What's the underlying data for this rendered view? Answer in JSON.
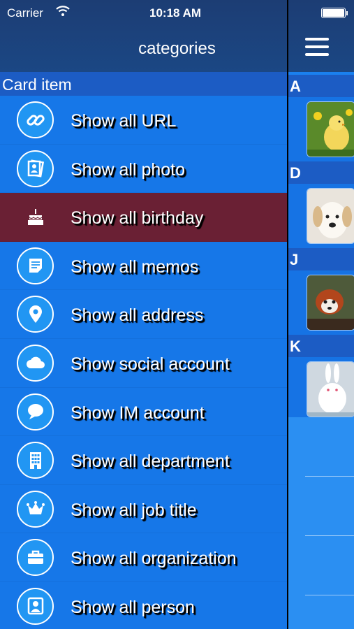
{
  "status_bar": {
    "carrier": "Carrier",
    "time": "10:18 AM"
  },
  "drawer": {
    "title": "categories",
    "section_header": "Card item",
    "items": [
      {
        "label": "Show all URL",
        "icon": "link-icon"
      },
      {
        "label": "Show all photo",
        "icon": "photos-icon"
      },
      {
        "label": "Show all birthday",
        "icon": "birthday-cake-icon",
        "selected": true
      },
      {
        "label": "Show all memos",
        "icon": "memo-icon"
      },
      {
        "label": "Show all address",
        "icon": "location-pin-icon"
      },
      {
        "label": "Show social account",
        "icon": "cloud-icon"
      },
      {
        "label": "Show IM account",
        "icon": "chat-bubble-icon"
      },
      {
        "label": "Show all department",
        "icon": "building-icon"
      },
      {
        "label": "Show all job title",
        "icon": "crown-icon"
      },
      {
        "label": "Show all organization",
        "icon": "briefcase-icon"
      },
      {
        "label": "Show all person",
        "icon": "person-icon"
      }
    ]
  },
  "contacts_peek": {
    "sections": [
      {
        "letter": "A",
        "thumb": "chick-photo"
      },
      {
        "letter": "D",
        "thumb": "puppy-photo"
      },
      {
        "letter": "J",
        "thumb": "red-panda-photo"
      },
      {
        "letter": "K",
        "thumb": "rabbit-photo"
      }
    ]
  },
  "colors": {
    "drawer_bg": "#1677e8",
    "header_bg": "#1b4784",
    "section_bg": "#1c5cc4",
    "selected_bg": "#6a2034"
  }
}
